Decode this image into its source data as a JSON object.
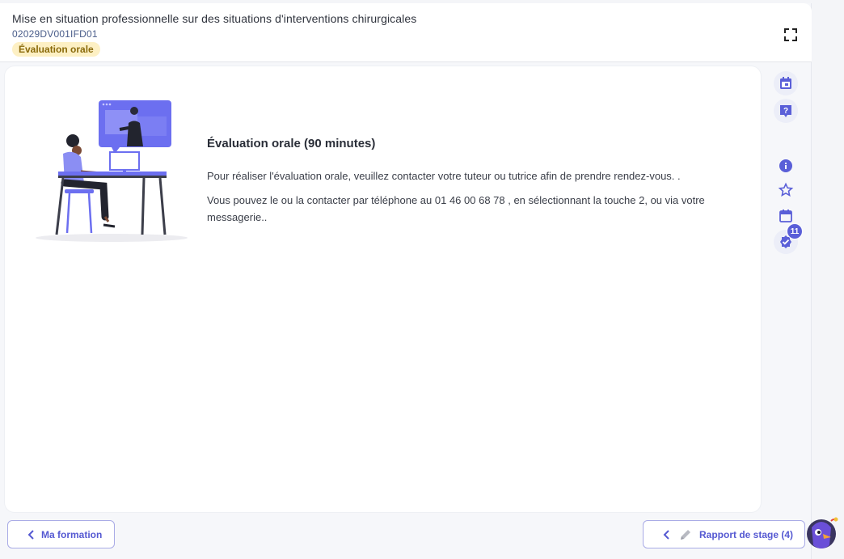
{
  "header": {
    "title": "Mise en situation professionnelle sur des situations d'interventions chirurgicales",
    "code": "02029DV001IFD01",
    "badge": "Évaluation orale",
    "fullscreen_icon": "fullscreen-icon"
  },
  "content": {
    "title": "Évaluation orale (90 minutes)",
    "paragraph_1": "Pour réaliser l'évaluation orale, veuillez contacter votre tuteur ou tutrice afin de prendre rendez-vous. .",
    "paragraph_2": "Vous pouvez le ou la contacter par téléphone au 01 46 00 68 78 , en sélectionnant la touche 2, ou via votre messagerie.."
  },
  "rail": {
    "items": [
      "calendar-icon",
      "help-icon",
      "info-icon",
      "star-icon",
      "calendar-outline-icon",
      "verified-icon"
    ],
    "badge_count": "11"
  },
  "footer": {
    "back_label": "Ma formation",
    "next_label": "Rapport de stage (4)"
  },
  "colors": {
    "accent": "#5a5fd8",
    "badge_bg": "#fdf0c4",
    "badge_text": "#8a6a0a"
  }
}
